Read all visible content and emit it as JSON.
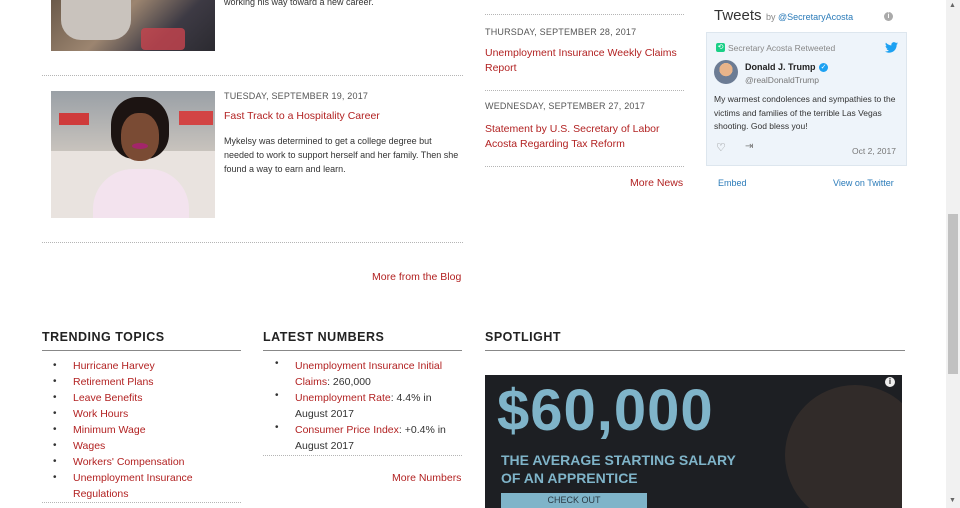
{
  "blog": {
    "top_summary": "working his way toward a new career.",
    "post": {
      "date": "TUESDAY, SEPTEMBER 19, 2017",
      "title": "Fast Track to a Hospitality Career",
      "summary": "Mykelsy was determined to get a college degree but needed to work to support herself and her family. Then she found a way to earn and learn."
    },
    "more_label": "More from the Blog"
  },
  "news": {
    "items": [
      {
        "date": "THURSDAY, SEPTEMBER 28, 2017",
        "title": "Unemployment Insurance Weekly Claims Report"
      },
      {
        "date": "WEDNESDAY, SEPTEMBER 27, 2017",
        "title": "Statement by U.S. Secretary of Labor Acosta Regarding Tax Reform"
      }
    ],
    "more_label": "More News"
  },
  "twitter": {
    "title": "Tweets",
    "by_prefix": "by",
    "account": "@SecretaryAcosta",
    "retweet_label": "Secretary Acosta Retweeted",
    "author_name": "Donald J. Trump",
    "author_handle": "@realDonaldTrump",
    "body": "My warmest condolences and sympathies to the victims and families of the terrible Las Vegas shooting. God bless you!",
    "date": "Oct 2, 2017",
    "embed_label": "Embed",
    "view_label": "View on Twitter",
    "brand_color": "#1da1f2"
  },
  "trending": {
    "heading": "TRENDING TOPICS",
    "items": [
      "Hurricane Harvey",
      "Retirement Plans",
      "Leave Benefits",
      "Work Hours",
      "Minimum Wage",
      "Wages",
      "Workers' Compensation",
      "Unemployment Insurance",
      "Regulations"
    ]
  },
  "numbers": {
    "heading": "LATEST NUMBERS",
    "items": [
      {
        "label": "Unemployment Insurance Initial Claims",
        "value": ": 260,000"
      },
      {
        "label": "Unemployment Rate",
        "value": ": 4.4% in August 2017"
      },
      {
        "label": "Consumer Price Index",
        "value": ": +0.4% in August 2017"
      }
    ],
    "more_label": "More Numbers"
  },
  "spotlight": {
    "heading": "SPOTLIGHT",
    "big": "$60,000",
    "line1": "THE AVERAGE STARTING SALARY",
    "line2": "OF AN APPRENTICE",
    "button": "CHECK OUT",
    "accent": "#7fb4c9"
  }
}
